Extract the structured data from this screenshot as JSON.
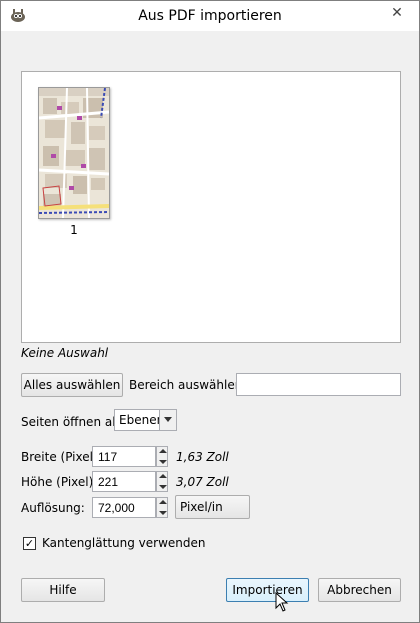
{
  "window": {
    "title": "Aus PDF importieren",
    "app_icon": "gimp-wilber-icon",
    "close_symbol": "✕"
  },
  "preview": {
    "pages": [
      {
        "label": "1"
      }
    ]
  },
  "selection_status": "Keine Auswahl",
  "select_all_label": "Alles auswählen",
  "range_label": "Bereich auswählen:",
  "range_value": "",
  "open_pages_as": {
    "label": "Seiten öffnen als",
    "value": "Ebenen"
  },
  "width": {
    "label": "Breite (Pixel):",
    "value": "117",
    "unit_text": "1,63 Zoll"
  },
  "height": {
    "label": "Höhe (Pixel):",
    "value": "221",
    "unit_text": "3,07 Zoll"
  },
  "resolution": {
    "label": "Auflösung:",
    "value": "72,000",
    "unit_button": "Pixel/in"
  },
  "antialias": {
    "label": "Kantenglättung verwenden",
    "checked": true
  },
  "buttons": {
    "help": "Hilfe",
    "import": "Importieren",
    "cancel": "Abbrechen"
  }
}
